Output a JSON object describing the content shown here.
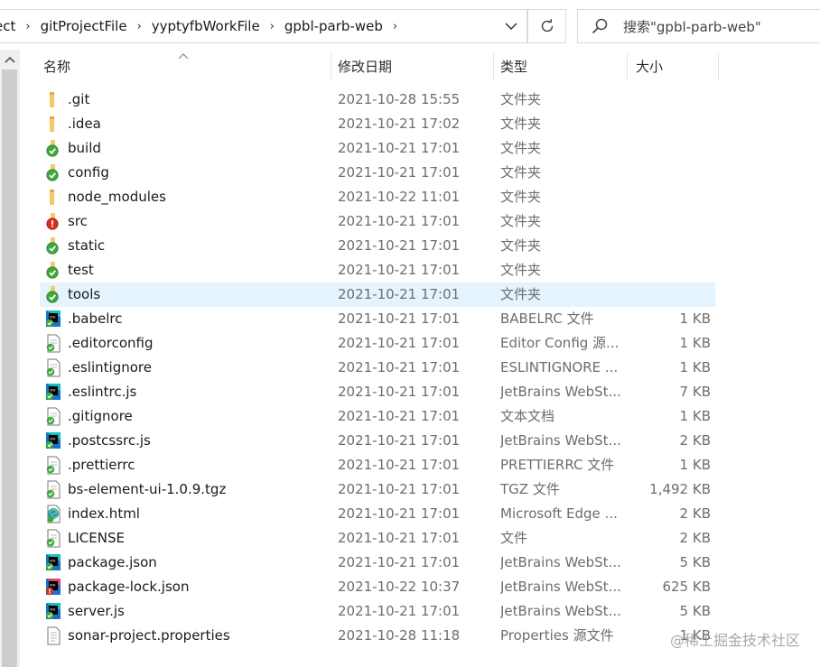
{
  "address": {
    "crumbs": [
      "ect",
      "gitProjectFile",
      "yyptyfbWorkFile",
      "gpbl-parb-web"
    ],
    "sep": "›"
  },
  "search": {
    "placeholder": "搜索\"gpbl-parb-web\""
  },
  "columns": {
    "name": "名称",
    "date": "修改日期",
    "type": "类型",
    "size": "大小"
  },
  "files": [
    {
      "name": ".git",
      "date": "2021-10-28 15:55",
      "type": "文件夹",
      "size": "",
      "icon": "folder-icon"
    },
    {
      "name": ".idea",
      "date": "2021-10-21 17:02",
      "type": "文件夹",
      "size": "",
      "icon": "folder-icon"
    },
    {
      "name": "build",
      "date": "2021-10-21 17:01",
      "type": "文件夹",
      "size": "",
      "icon": "folder-ok-icon"
    },
    {
      "name": "config",
      "date": "2021-10-21 17:01",
      "type": "文件夹",
      "size": "",
      "icon": "folder-ok-icon"
    },
    {
      "name": "node_modules",
      "date": "2021-10-22 11:01",
      "type": "文件夹",
      "size": "",
      "icon": "folder-icon"
    },
    {
      "name": "src",
      "date": "2021-10-21 17:01",
      "type": "文件夹",
      "size": "",
      "icon": "folder-modified-icon"
    },
    {
      "name": "static",
      "date": "2021-10-21 17:01",
      "type": "文件夹",
      "size": "",
      "icon": "folder-ok-icon"
    },
    {
      "name": "test",
      "date": "2021-10-21 17:01",
      "type": "文件夹",
      "size": "",
      "icon": "folder-ok-icon"
    },
    {
      "name": "tools",
      "date": "2021-10-21 17:01",
      "type": "文件夹",
      "size": "",
      "icon": "folder-ok-icon",
      "selected": true
    },
    {
      "name": ".babelrc",
      "date": "2021-10-21 17:01",
      "type": "BABELRC 文件",
      "size": "1 KB",
      "icon": "webstorm-file-icon"
    },
    {
      "name": ".editorconfig",
      "date": "2021-10-21 17:01",
      "type": "Editor Config 源...",
      "size": "1 KB",
      "icon": "text-file-ok-icon"
    },
    {
      "name": ".eslintignore",
      "date": "2021-10-21 17:01",
      "type": "ESLINTIGNORE ...",
      "size": "1 KB",
      "icon": "text-file-ok-icon"
    },
    {
      "name": ".eslintrc.js",
      "date": "2021-10-21 17:01",
      "type": "JetBrains WebSt...",
      "size": "7 KB",
      "icon": "webstorm-file-icon"
    },
    {
      "name": ".gitignore",
      "date": "2021-10-21 17:01",
      "type": "文本文档",
      "size": "1 KB",
      "icon": "text-file-ok-icon"
    },
    {
      "name": ".postcssrc.js",
      "date": "2021-10-21 17:01",
      "type": "JetBrains WebSt...",
      "size": "2 KB",
      "icon": "webstorm-file-icon"
    },
    {
      "name": ".prettierrc",
      "date": "2021-10-21 17:01",
      "type": "PRETTIERRC 文件",
      "size": "1 KB",
      "icon": "text-file-ok-icon"
    },
    {
      "name": "bs-element-ui-1.0.9.tgz",
      "date": "2021-10-21 17:01",
      "type": "TGZ 文件",
      "size": "1,492 KB",
      "icon": "text-file-ok-icon"
    },
    {
      "name": "index.html",
      "date": "2021-10-21 17:01",
      "type": "Microsoft Edge ...",
      "size": "2 KB",
      "icon": "edge-file-icon"
    },
    {
      "name": "LICENSE",
      "date": "2021-10-21 17:01",
      "type": "文件",
      "size": "2 KB",
      "icon": "text-file-ok-icon"
    },
    {
      "name": "package.json",
      "date": "2021-10-21 17:01",
      "type": "JetBrains WebSt...",
      "size": "5 KB",
      "icon": "webstorm-file-icon"
    },
    {
      "name": "package-lock.json",
      "date": "2021-10-22 10:37",
      "type": "JetBrains WebSt...",
      "size": "625 KB",
      "icon": "webstorm-file-modified-icon"
    },
    {
      "name": "server.js",
      "date": "2021-10-21 17:01",
      "type": "JetBrains WebSt...",
      "size": "5 KB",
      "icon": "webstorm-file-icon"
    },
    {
      "name": "sonar-project.properties",
      "date": "2021-10-28 11:18",
      "type": "Properties 源文件",
      "size": "1 KB",
      "icon": "text-file-icon"
    }
  ],
  "watermark": "@稀土掘金技术社区"
}
